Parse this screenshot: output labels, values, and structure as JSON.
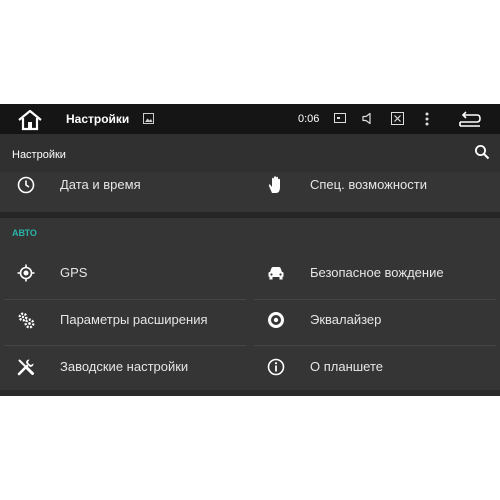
{
  "statusbar": {
    "title": "Настройки",
    "clock": "0:06"
  },
  "toolbar": {
    "title": "Настройки"
  },
  "top_row": {
    "left_label": "Дата и время",
    "right_label": "Спец. возможности"
  },
  "section": {
    "title": "АВТО",
    "items": [
      {
        "label": "GPS"
      },
      {
        "label": "Безопасное вождение"
      },
      {
        "label": "Параметры расширения"
      },
      {
        "label": "Эквалайзер"
      },
      {
        "label": "Заводские настройки"
      },
      {
        "label": "О планшете"
      }
    ]
  },
  "colors": {
    "accent": "#29b5a8",
    "background": "#2b2b2b",
    "statusbar": "#151515"
  }
}
